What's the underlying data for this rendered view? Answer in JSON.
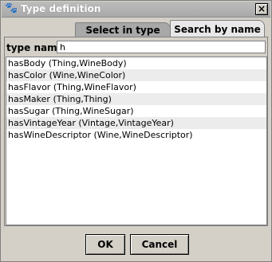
{
  "window": {
    "title": "Type definition",
    "close_glyph": "×",
    "icon": "paw-icon"
  },
  "tabs": [
    {
      "label": "Select in type tree",
      "selected": false
    },
    {
      "label": "Search by name",
      "selected": true
    }
  ],
  "search": {
    "label": "type name:",
    "value": "h"
  },
  "results": [
    "hasBody (Thing,WineBody)",
    "hasColor (Wine,WineColor)",
    "hasFlavor (Thing,WineFlavor)",
    "hasMaker (Thing,Thing)",
    "hasSugar (Thing,WineSugar)",
    "hasVintageYear (Vintage,VintageYear)",
    "hasWineDescriptor (Wine,WineDescriptor)"
  ],
  "buttons": {
    "ok": "OK",
    "cancel": "Cancel"
  }
}
